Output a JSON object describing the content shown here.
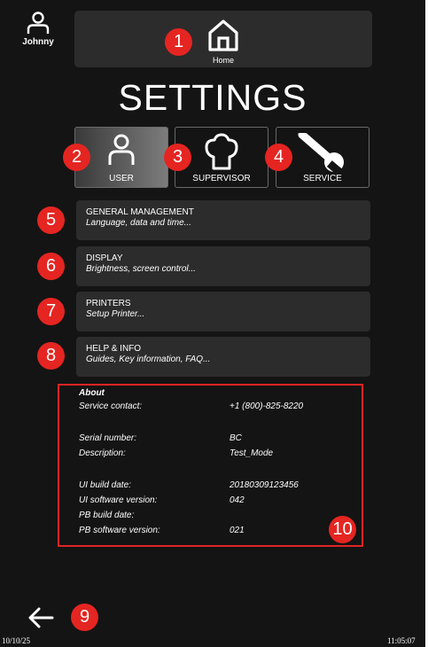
{
  "user": {
    "name": "Johnny"
  },
  "home": {
    "label": "Home"
  },
  "page": {
    "title": "SETTINGS"
  },
  "roles": [
    {
      "label": "USER",
      "active": true
    },
    {
      "label": "SUPERVISOR",
      "active": false
    },
    {
      "label": "SERVICE",
      "active": false
    }
  ],
  "menu": [
    {
      "title": "GENERAL MANAGEMENT",
      "subtitle": "Language, data and time..."
    },
    {
      "title": "DISPLAY",
      "subtitle": "Brightness, screen control..."
    },
    {
      "title": "PRINTERS",
      "subtitle": "Setup Printer..."
    },
    {
      "title": "HELP & INFO",
      "subtitle": "Guides, Key information, FAQ..."
    }
  ],
  "about": {
    "heading": "About",
    "service_contact_label": "Service contact:",
    "service_contact_value": "+1 (800)-825-8220",
    "serial_number_label": "Serial number:",
    "serial_number_value": "BC",
    "description_label": "Description:",
    "description_value": "Test_Mode",
    "ui_build_date_label": "UI build date:",
    "ui_build_date_value": "20180309123456",
    "ui_software_version_label": "UI software version:",
    "ui_software_version_value": "042",
    "pb_build_date_label": "PB build date:",
    "pb_build_date_value": "",
    "pb_software_version_label": "PB software version:",
    "pb_software_version_value": "021"
  },
  "footer": {
    "date": "10/10/25",
    "time": "11:05:07"
  },
  "annotations": [
    "1",
    "2",
    "3",
    "4",
    "5",
    "6",
    "7",
    "8",
    "9",
    "10"
  ],
  "colors": {
    "background": "#141414",
    "panel": "#2c2c2c",
    "badge": "#e52521",
    "highlight_box": "#e02424"
  },
  "icons": [
    "user-icon",
    "home-icon",
    "chef-hat-icon",
    "wrench-icon",
    "back-arrow-icon"
  ]
}
